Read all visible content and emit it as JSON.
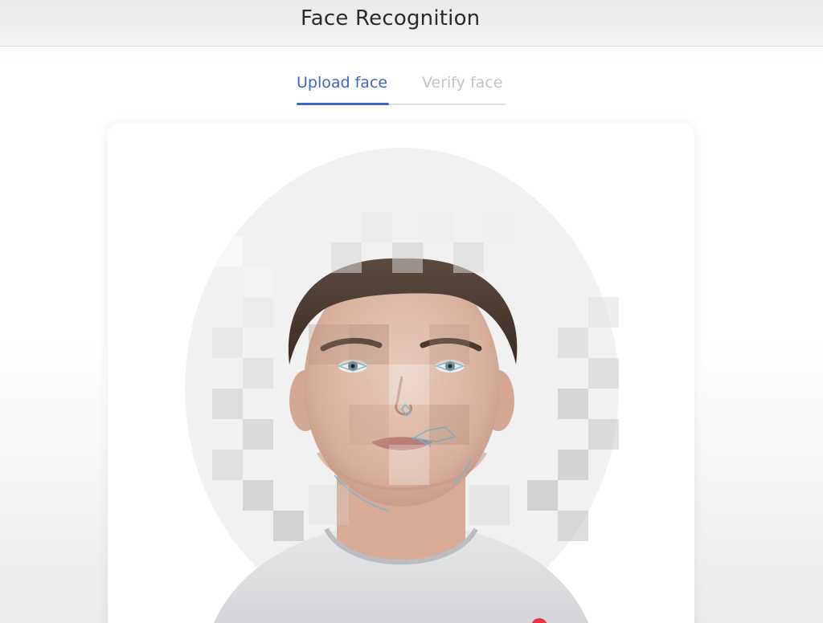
{
  "header": {
    "title": "Face Recognition"
  },
  "tabs": [
    {
      "label": "Upload face",
      "active": true
    },
    {
      "label": "Verify face",
      "active": false
    }
  ],
  "colors": {
    "accent": "#3f63c7",
    "inactive_tab": "#c3c3c3",
    "dot": "#e53545"
  },
  "preview": {
    "subject": "face-preview-image",
    "overlay": "pixelated-mosaic-with-landmarks"
  }
}
